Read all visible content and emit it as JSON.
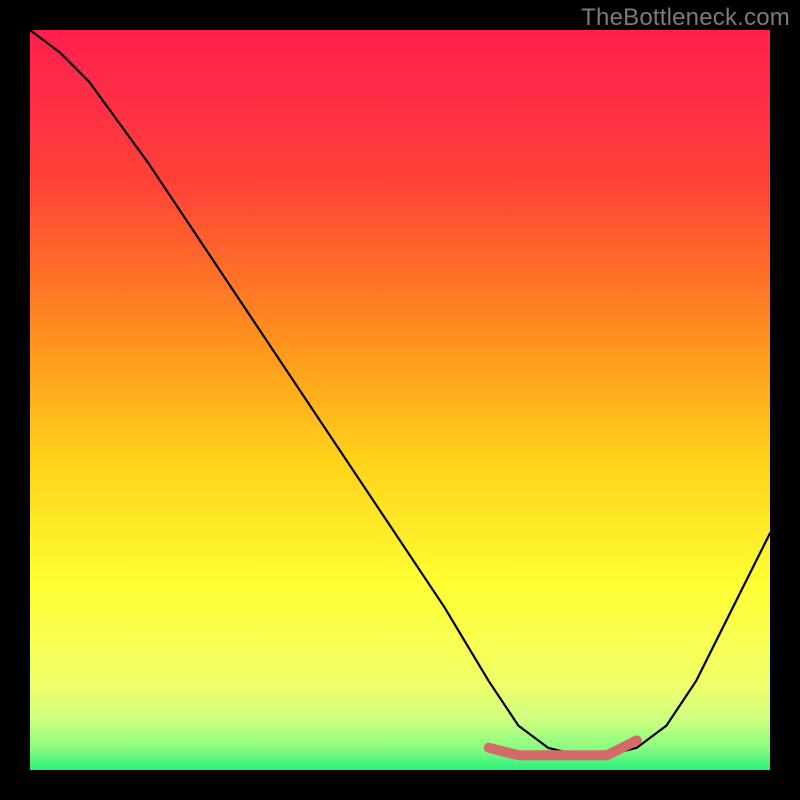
{
  "watermark": "TheBottleneck.com",
  "chart_data": {
    "type": "line",
    "title": "",
    "xlabel": "",
    "ylabel": "",
    "xlim": [
      0,
      100
    ],
    "ylim": [
      0,
      100
    ],
    "grid": false,
    "legend": false,
    "series": [
      {
        "name": "gradient-background",
        "role": "background",
        "gradient_stops": [
          {
            "pos": 0.0,
            "color": "#ff1f4f"
          },
          {
            "pos": 0.2,
            "color": "#ff4038"
          },
          {
            "pos": 0.4,
            "color": "#ff8a1f"
          },
          {
            "pos": 0.58,
            "color": "#ffd21a"
          },
          {
            "pos": 0.75,
            "color": "#ffff33"
          },
          {
            "pos": 0.88,
            "color": "#f1ff66"
          },
          {
            "pos": 0.93,
            "color": "#d0ff80"
          },
          {
            "pos": 0.97,
            "color": "#8afc80"
          },
          {
            "pos": 1.0,
            "color": "#2bf07a"
          }
        ]
      },
      {
        "name": "bottleneck-curve",
        "x": [
          0,
          4,
          8,
          16,
          24,
          32,
          40,
          48,
          56,
          62,
          66,
          70,
          74,
          78,
          82,
          86,
          90,
          94,
          98,
          100
        ],
        "values": [
          100,
          97,
          93,
          82,
          70,
          58,
          46,
          34,
          22,
          12,
          6,
          3,
          2,
          2,
          3,
          6,
          12,
          20,
          28,
          32
        ]
      },
      {
        "name": "optimal-range-highlight",
        "x": [
          62,
          66,
          70,
          74,
          78,
          82
        ],
        "values": [
          3,
          2,
          2,
          2,
          2,
          4
        ],
        "color": "#d46a6a"
      }
    ]
  }
}
